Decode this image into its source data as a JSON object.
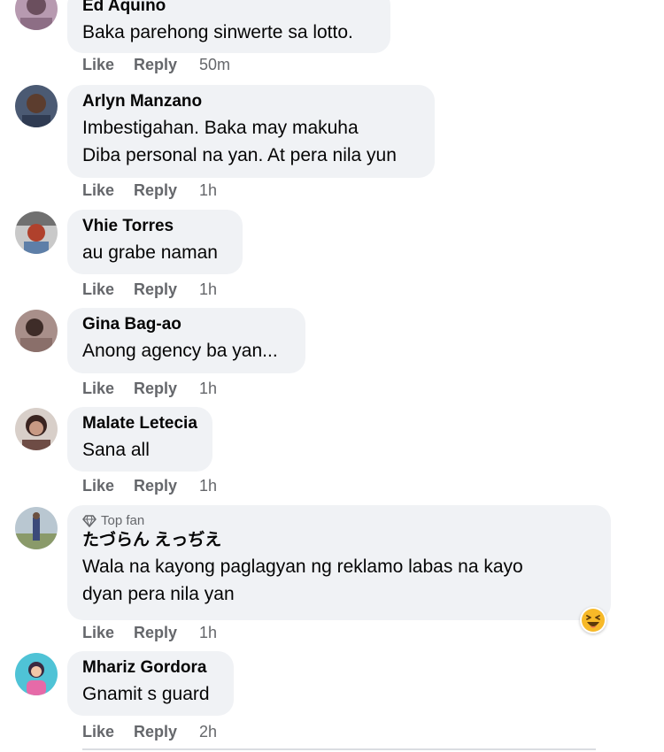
{
  "comments": [
    {
      "author": "Ed Aquino",
      "lines": [
        "Baka parehong sinwerte sa lotto."
      ],
      "like": "Like",
      "reply": "Reply",
      "time": "50m"
    },
    {
      "author": "Arlyn Manzano",
      "lines": [
        "Imbestigahan. Baka may makuha",
        "Diba personal na yan. At pera nila yun"
      ],
      "like": "Like",
      "reply": "Reply",
      "time": "1h"
    },
    {
      "author": "Vhie Torres",
      "lines": [
        "au grabe naman"
      ],
      "like": "Like",
      "reply": "Reply",
      "time": "1h"
    },
    {
      "author": "Gina Bag-ao",
      "lines": [
        "Anong agency ba yan..."
      ],
      "like": "Like",
      "reply": "Reply",
      "time": "1h"
    },
    {
      "author": "Malate Letecia",
      "lines": [
        "Sana all"
      ],
      "like": "Like",
      "reply": "Reply",
      "time": "1h"
    },
    {
      "badge": "Top fan",
      "author": "たづらん えっぢえ",
      "lines": [
        "Wala na kayong paglagyan ng reklamo labas na kayo",
        "dyan pera nila yan"
      ],
      "like": "Like",
      "reply": "Reply",
      "time": "1h",
      "reaction_icon": "laughing-emoji"
    },
    {
      "author": "Mhariz Gordora",
      "lines": [
        "Gnamit s guard"
      ],
      "like": "Like",
      "reply": "Reply",
      "time": "2h"
    }
  ],
  "colors": {
    "bubble": "#f0f2f5",
    "secondary_text": "#65676b",
    "reaction_yellow": "#f7b928"
  }
}
